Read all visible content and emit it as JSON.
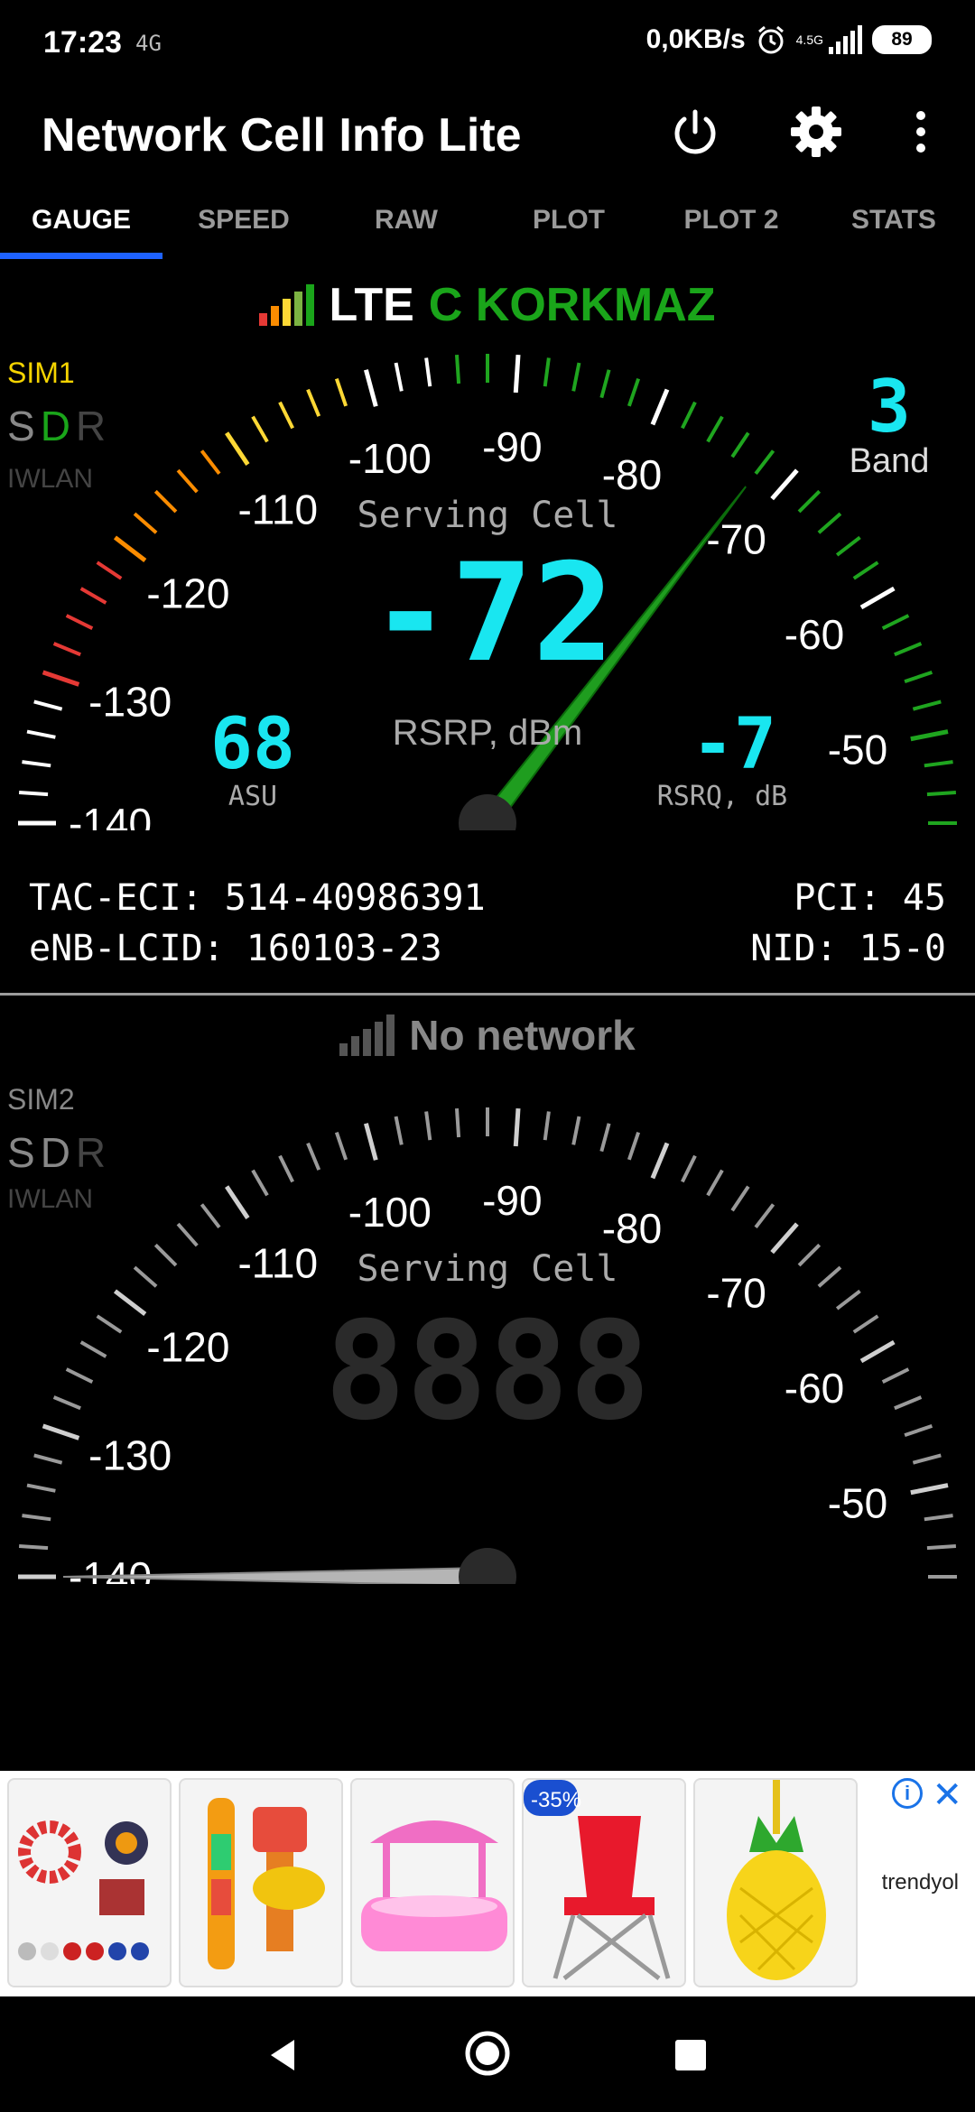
{
  "status_bar": {
    "time": "17:23",
    "left_network": "4G",
    "speed": "0,0KB/s",
    "network_type": "4.5G",
    "battery": "89"
  },
  "app": {
    "title": "Network Cell Info Lite",
    "icons": [
      "power-icon",
      "gear-icon",
      "more-vert-icon"
    ]
  },
  "tabs": [
    "GAUGE",
    "SPEED",
    "RAW",
    "PLOT",
    "PLOT 2",
    "STATS"
  ],
  "active_tab": 0,
  "sim1": {
    "tech": "LTE",
    "operator": "C KORKMAZ",
    "sim_label": "SIM1",
    "sdr": [
      "S",
      "D",
      "R"
    ],
    "iwlan": "IWLAN",
    "band_value": "3",
    "band_label": "Band",
    "center_label": "Serving Cell",
    "rsrp_value": "-72",
    "rsrp_unit": "RSRP, dBm",
    "asu_value": "68",
    "asu_label": "ASU",
    "rsrq_value": "-7",
    "rsrq_label": "RSRQ, dB",
    "tac_eci": "TAC-ECI: 514-40986391",
    "enb_lcid": "eNB-LCID: 160103-23",
    "pci": "PCI: 45",
    "nid": "NID: 15-0",
    "needle_dbm": -72
  },
  "sim2": {
    "status": "No network",
    "sim_label": "SIM2",
    "sdr": [
      "S",
      "D",
      "R"
    ],
    "iwlan": "IWLAN",
    "center_label": "Serving Cell",
    "needle_dbm": -140
  },
  "gauge_scale": {
    "labels": [
      "-140",
      "-130",
      "-120",
      "-110",
      "-100",
      "-90",
      "-80",
      "-70",
      "-60",
      "-50"
    ],
    "min": -140,
    "max": -44
  },
  "colors": {
    "tab_indicator": "#1e62ff",
    "operator": "#1aa51a",
    "digit": "#19e6f0",
    "needle": "#1f9d1f",
    "sim1_label": "#f5d400"
  },
  "ad": {
    "brand": "trendyol",
    "discount": "-35%",
    "items": [
      "magnetic-balls",
      "magic-kitchen-toy",
      "kiddie-pool",
      "folding-chair",
      "pineapple-cup"
    ]
  },
  "nav": [
    "back-icon",
    "home-icon",
    "recents-icon"
  ]
}
